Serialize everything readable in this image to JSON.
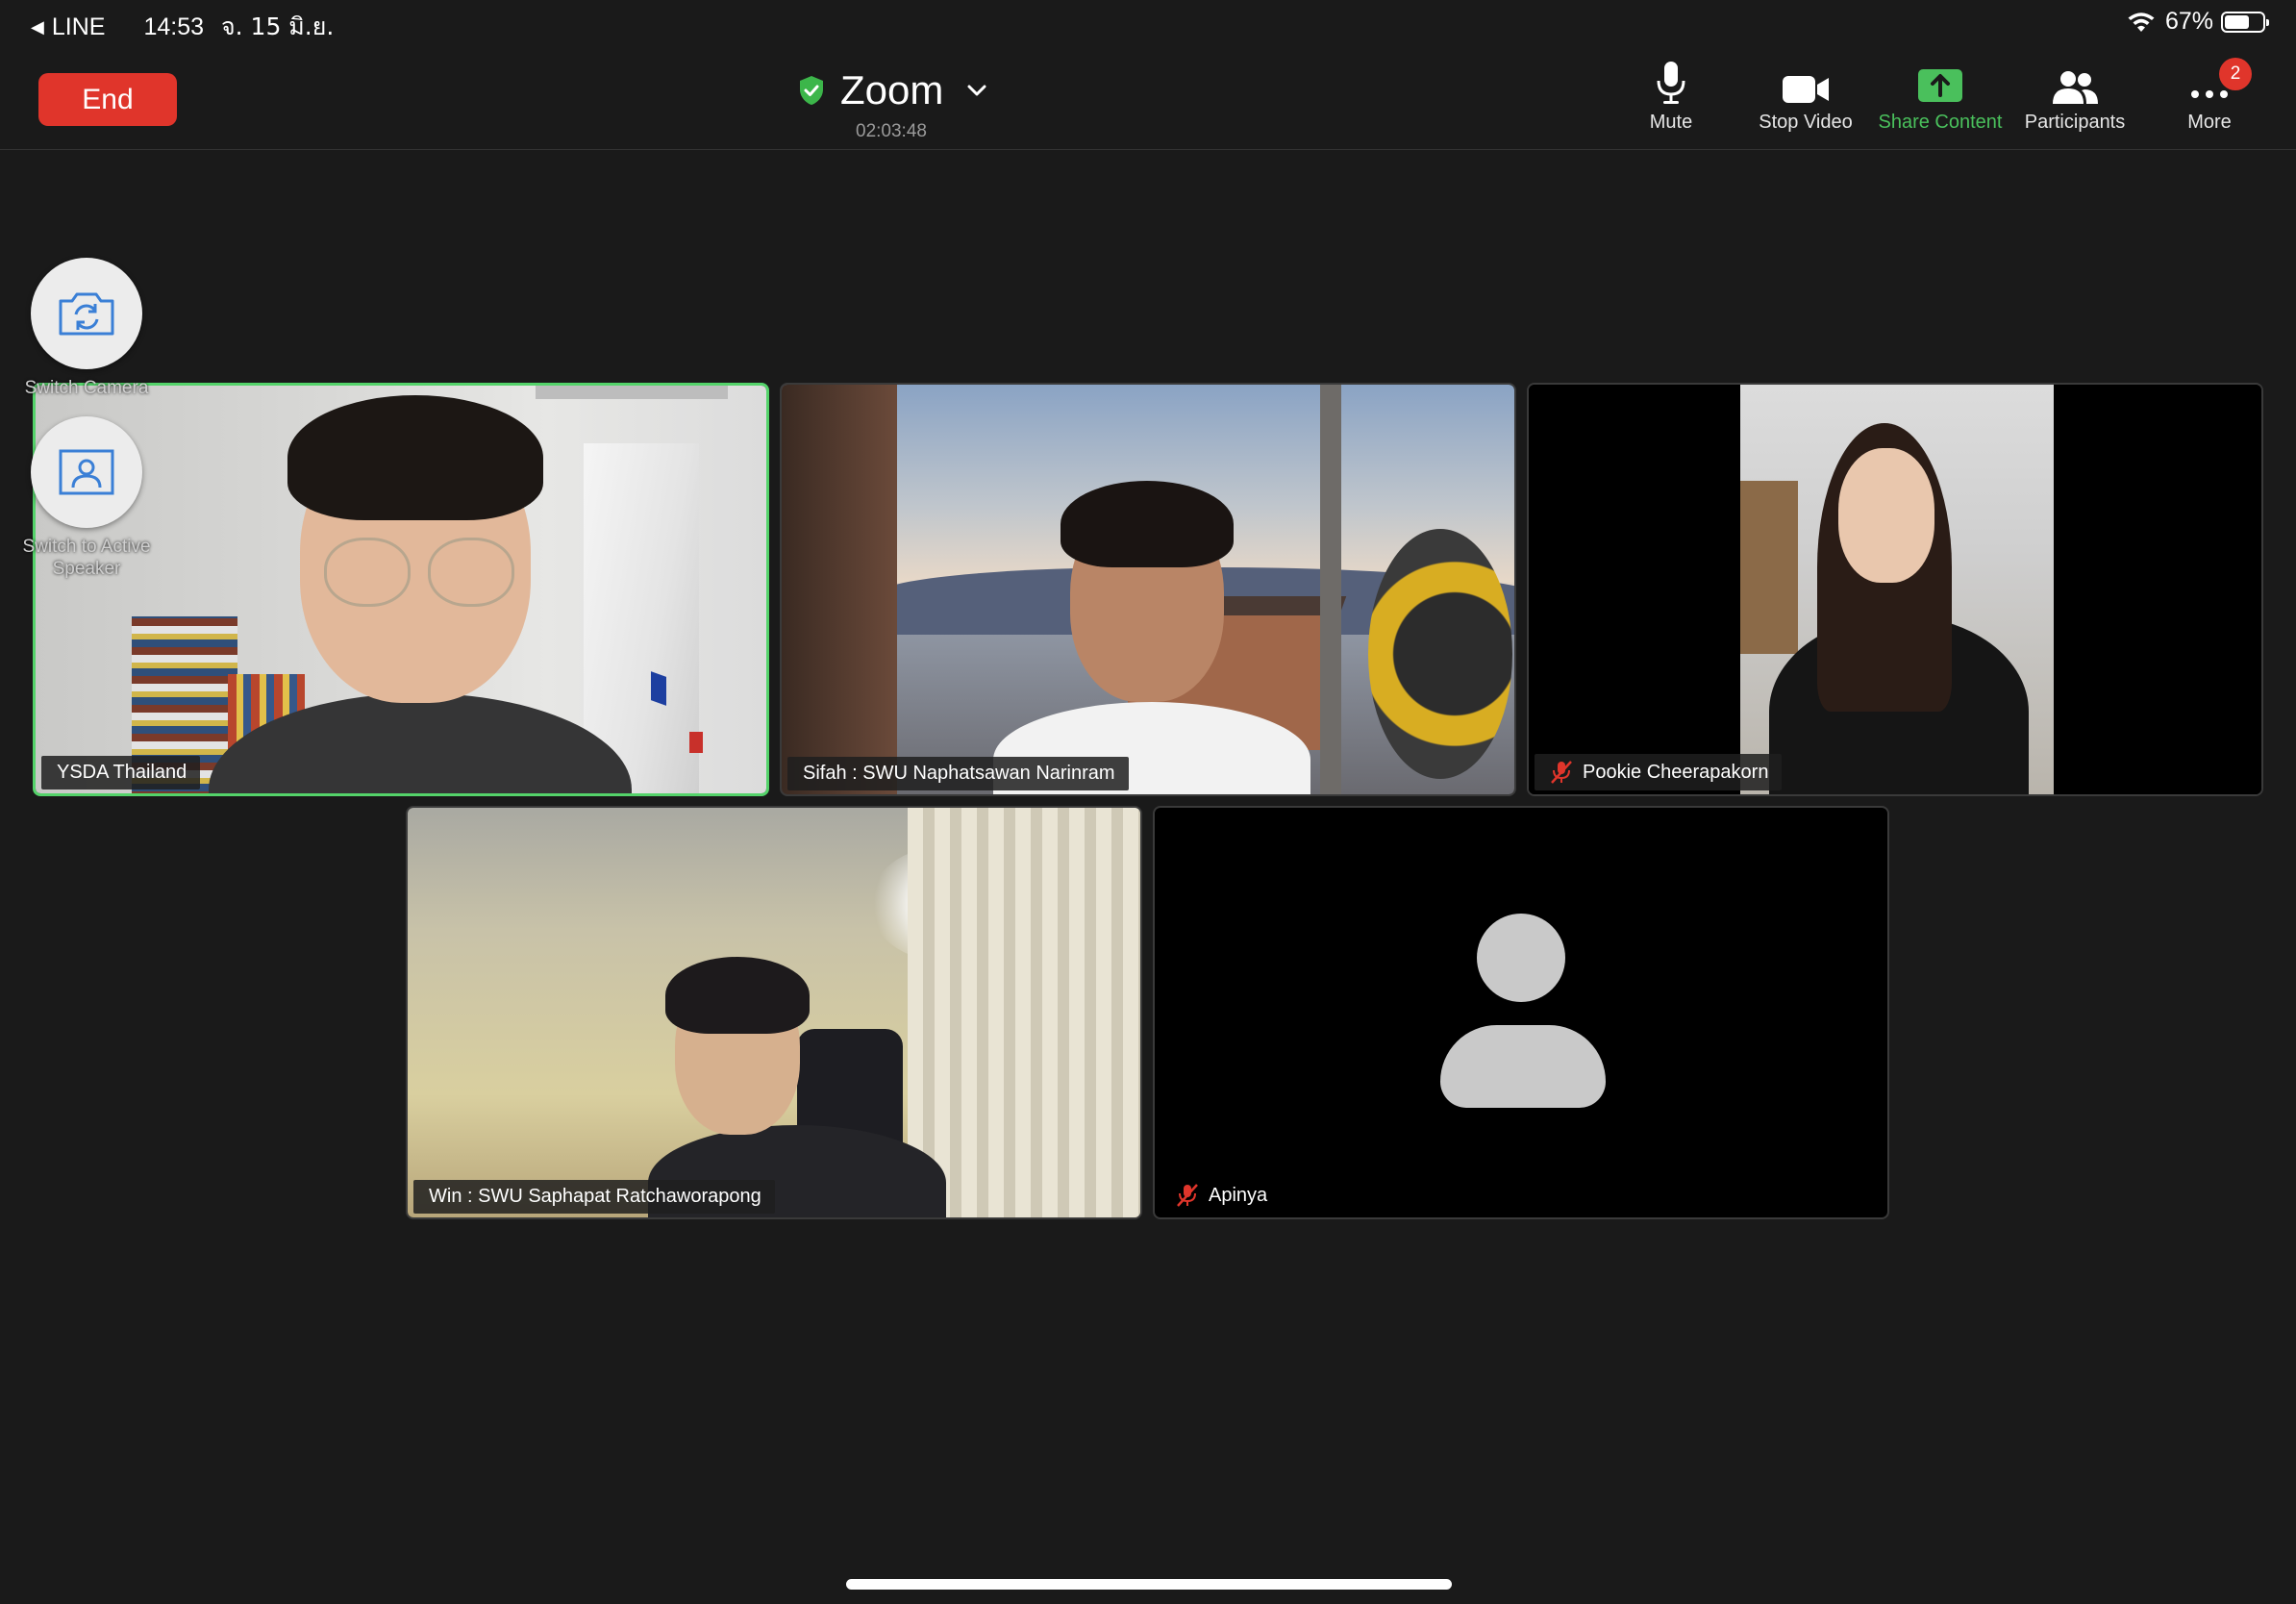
{
  "status_bar": {
    "back_app": "LINE",
    "time": "14:53",
    "date": "จ. 15 มิ.ย.",
    "battery_percent_label": "67%",
    "battery_level": 0.67
  },
  "toolbar": {
    "end_label": "End",
    "meeting_title": "Zoom",
    "timer": "02:03:48",
    "actions": {
      "mute": "Mute",
      "stop_video": "Stop Video",
      "share_content": "Share Content",
      "participants": "Participants",
      "more": "More",
      "more_badge": "2"
    }
  },
  "side_controls": {
    "switch_camera": "Switch Camera",
    "switch_speaker": "Switch to Active Speaker"
  },
  "participants": [
    {
      "name": "YSDA Thailand",
      "muted": false,
      "active": true
    },
    {
      "name": "Sifah : SWU Naphatsawan Narinram",
      "muted": false,
      "active": false
    },
    {
      "name": "Pookie Cheerapakorn",
      "muted": true,
      "active": false
    },
    {
      "name": "Win : SWU Saphapat Ratchaworapong",
      "muted": false,
      "active": false
    },
    {
      "name": "Apinya",
      "muted": true,
      "active": false,
      "video_off": true
    }
  ],
  "colors": {
    "end_button": "#e0352b",
    "share_green": "#4ac05c",
    "active_speaker_border": "#54d36a",
    "background": "#1a1a1a"
  }
}
